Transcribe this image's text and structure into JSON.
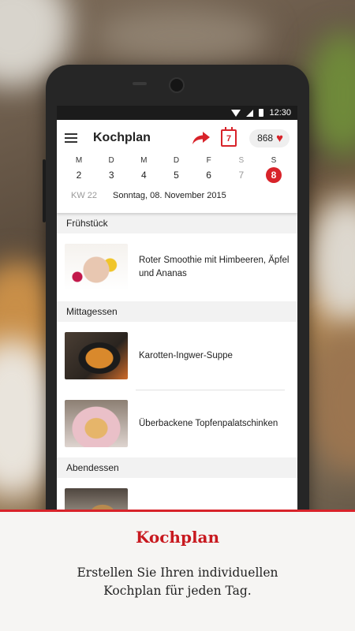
{
  "status": {
    "time": "12:30"
  },
  "app": {
    "title": "Kochplan",
    "calendar_day": "7",
    "favorites_count": "868"
  },
  "week": [
    {
      "letter": "M",
      "num": "2",
      "state": "normal"
    },
    {
      "letter": "D",
      "num": "3",
      "state": "normal"
    },
    {
      "letter": "M",
      "num": "4",
      "state": "normal"
    },
    {
      "letter": "D",
      "num": "5",
      "state": "normal"
    },
    {
      "letter": "F",
      "num": "6",
      "state": "normal"
    },
    {
      "letter": "S",
      "num": "7",
      "state": "weekend"
    },
    {
      "letter": "S",
      "num": "8",
      "state": "selected"
    }
  ],
  "date_row": {
    "kw": "KW 22",
    "date": "Sonntag, 08. November 2015"
  },
  "sections": [
    {
      "title": "Frühstück",
      "items": [
        {
          "text": "Roter Smoothie mit Himbeeren, Äpfel und Ananas",
          "image": "smoothie"
        }
      ]
    },
    {
      "title": "Mittagessen",
      "items": [
        {
          "text": "Karotten-Ingwer-Suppe",
          "image": "soup"
        },
        {
          "text": "Überbackene Topfenpalatschinken",
          "image": "pancakes"
        }
      ]
    },
    {
      "title": "Abendessen",
      "items": [
        {
          "text": "",
          "image": "dinner"
        }
      ]
    }
  ],
  "caption": {
    "title": "Kochplan",
    "line1": "Erstellen Sie Ihren individuellen",
    "line2": "Kochplan für jeden Tag."
  },
  "colors": {
    "accent": "#d8232a"
  }
}
